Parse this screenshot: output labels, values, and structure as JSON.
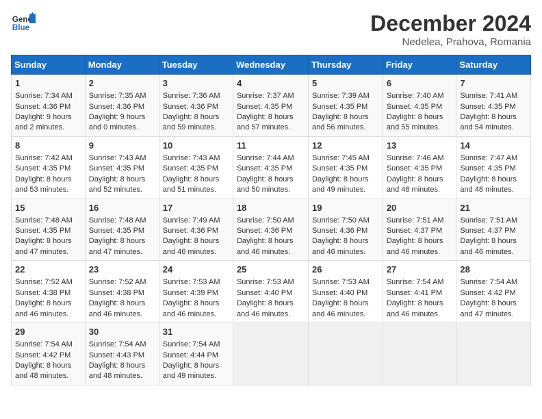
{
  "header": {
    "logo_line1": "General",
    "logo_line2": "Blue",
    "title": "December 2024",
    "subtitle": "Nedelea, Prahova, Romania"
  },
  "weekdays": [
    "Sunday",
    "Monday",
    "Tuesday",
    "Wednesday",
    "Thursday",
    "Friday",
    "Saturday"
  ],
  "weeks": [
    [
      {
        "day": "1",
        "lines": [
          "Sunrise: 7:34 AM",
          "Sunset: 4:36 PM",
          "Daylight: 9 hours",
          "and 2 minutes."
        ]
      },
      {
        "day": "2",
        "lines": [
          "Sunrise: 7:35 AM",
          "Sunset: 4:36 PM",
          "Daylight: 9 hours",
          "and 0 minutes."
        ]
      },
      {
        "day": "3",
        "lines": [
          "Sunrise: 7:36 AM",
          "Sunset: 4:36 PM",
          "Daylight: 8 hours",
          "and 59 minutes."
        ]
      },
      {
        "day": "4",
        "lines": [
          "Sunrise: 7:37 AM",
          "Sunset: 4:35 PM",
          "Daylight: 8 hours",
          "and 57 minutes."
        ]
      },
      {
        "day": "5",
        "lines": [
          "Sunrise: 7:39 AM",
          "Sunset: 4:35 PM",
          "Daylight: 8 hours",
          "and 56 minutes."
        ]
      },
      {
        "day": "6",
        "lines": [
          "Sunrise: 7:40 AM",
          "Sunset: 4:35 PM",
          "Daylight: 8 hours",
          "and 55 minutes."
        ]
      },
      {
        "day": "7",
        "lines": [
          "Sunrise: 7:41 AM",
          "Sunset: 4:35 PM",
          "Daylight: 8 hours",
          "and 54 minutes."
        ]
      }
    ],
    [
      {
        "day": "8",
        "lines": [
          "Sunrise: 7:42 AM",
          "Sunset: 4:35 PM",
          "Daylight: 8 hours",
          "and 53 minutes."
        ]
      },
      {
        "day": "9",
        "lines": [
          "Sunrise: 7:43 AM",
          "Sunset: 4:35 PM",
          "Daylight: 8 hours",
          "and 52 minutes."
        ]
      },
      {
        "day": "10",
        "lines": [
          "Sunrise: 7:43 AM",
          "Sunset: 4:35 PM",
          "Daylight: 8 hours",
          "and 51 minutes."
        ]
      },
      {
        "day": "11",
        "lines": [
          "Sunrise: 7:44 AM",
          "Sunset: 4:35 PM",
          "Daylight: 8 hours",
          "and 50 minutes."
        ]
      },
      {
        "day": "12",
        "lines": [
          "Sunrise: 7:45 AM",
          "Sunset: 4:35 PM",
          "Daylight: 8 hours",
          "and 49 minutes."
        ]
      },
      {
        "day": "13",
        "lines": [
          "Sunrise: 7:46 AM",
          "Sunset: 4:35 PM",
          "Daylight: 8 hours",
          "and 48 minutes."
        ]
      },
      {
        "day": "14",
        "lines": [
          "Sunrise: 7:47 AM",
          "Sunset: 4:35 PM",
          "Daylight: 8 hours",
          "and 48 minutes."
        ]
      }
    ],
    [
      {
        "day": "15",
        "lines": [
          "Sunrise: 7:48 AM",
          "Sunset: 4:35 PM",
          "Daylight: 8 hours",
          "and 47 minutes."
        ]
      },
      {
        "day": "16",
        "lines": [
          "Sunrise: 7:48 AM",
          "Sunset: 4:35 PM",
          "Daylight: 8 hours",
          "and 47 minutes."
        ]
      },
      {
        "day": "17",
        "lines": [
          "Sunrise: 7:49 AM",
          "Sunset: 4:36 PM",
          "Daylight: 8 hours",
          "and 46 minutes."
        ]
      },
      {
        "day": "18",
        "lines": [
          "Sunrise: 7:50 AM",
          "Sunset: 4:36 PM",
          "Daylight: 8 hours",
          "and 46 minutes."
        ]
      },
      {
        "day": "19",
        "lines": [
          "Sunrise: 7:50 AM",
          "Sunset: 4:36 PM",
          "Daylight: 8 hours",
          "and 46 minutes."
        ]
      },
      {
        "day": "20",
        "lines": [
          "Sunrise: 7:51 AM",
          "Sunset: 4:37 PM",
          "Daylight: 8 hours",
          "and 46 minutes."
        ]
      },
      {
        "day": "21",
        "lines": [
          "Sunrise: 7:51 AM",
          "Sunset: 4:37 PM",
          "Daylight: 8 hours",
          "and 46 minutes."
        ]
      }
    ],
    [
      {
        "day": "22",
        "lines": [
          "Sunrise: 7:52 AM",
          "Sunset: 4:38 PM",
          "Daylight: 8 hours",
          "and 46 minutes."
        ]
      },
      {
        "day": "23",
        "lines": [
          "Sunrise: 7:52 AM",
          "Sunset: 4:38 PM",
          "Daylight: 8 hours",
          "and 46 minutes."
        ]
      },
      {
        "day": "24",
        "lines": [
          "Sunrise: 7:53 AM",
          "Sunset: 4:39 PM",
          "Daylight: 8 hours",
          "and 46 minutes."
        ]
      },
      {
        "day": "25",
        "lines": [
          "Sunrise: 7:53 AM",
          "Sunset: 4:40 PM",
          "Daylight: 8 hours",
          "and 46 minutes."
        ]
      },
      {
        "day": "26",
        "lines": [
          "Sunrise: 7:53 AM",
          "Sunset: 4:40 PM",
          "Daylight: 8 hours",
          "and 46 minutes."
        ]
      },
      {
        "day": "27",
        "lines": [
          "Sunrise: 7:54 AM",
          "Sunset: 4:41 PM",
          "Daylight: 8 hours",
          "and 46 minutes."
        ]
      },
      {
        "day": "28",
        "lines": [
          "Sunrise: 7:54 AM",
          "Sunset: 4:42 PM",
          "Daylight: 8 hours",
          "and 47 minutes."
        ]
      }
    ],
    [
      {
        "day": "29",
        "lines": [
          "Sunrise: 7:54 AM",
          "Sunset: 4:42 PM",
          "Daylight: 8 hours",
          "and 48 minutes."
        ]
      },
      {
        "day": "30",
        "lines": [
          "Sunrise: 7:54 AM",
          "Sunset: 4:43 PM",
          "Daylight: 8 hours",
          "and 48 minutes."
        ]
      },
      {
        "day": "31",
        "lines": [
          "Sunrise: 7:54 AM",
          "Sunset: 4:44 PM",
          "Daylight: 8 hours",
          "and 49 minutes."
        ]
      },
      null,
      null,
      null,
      null
    ]
  ]
}
